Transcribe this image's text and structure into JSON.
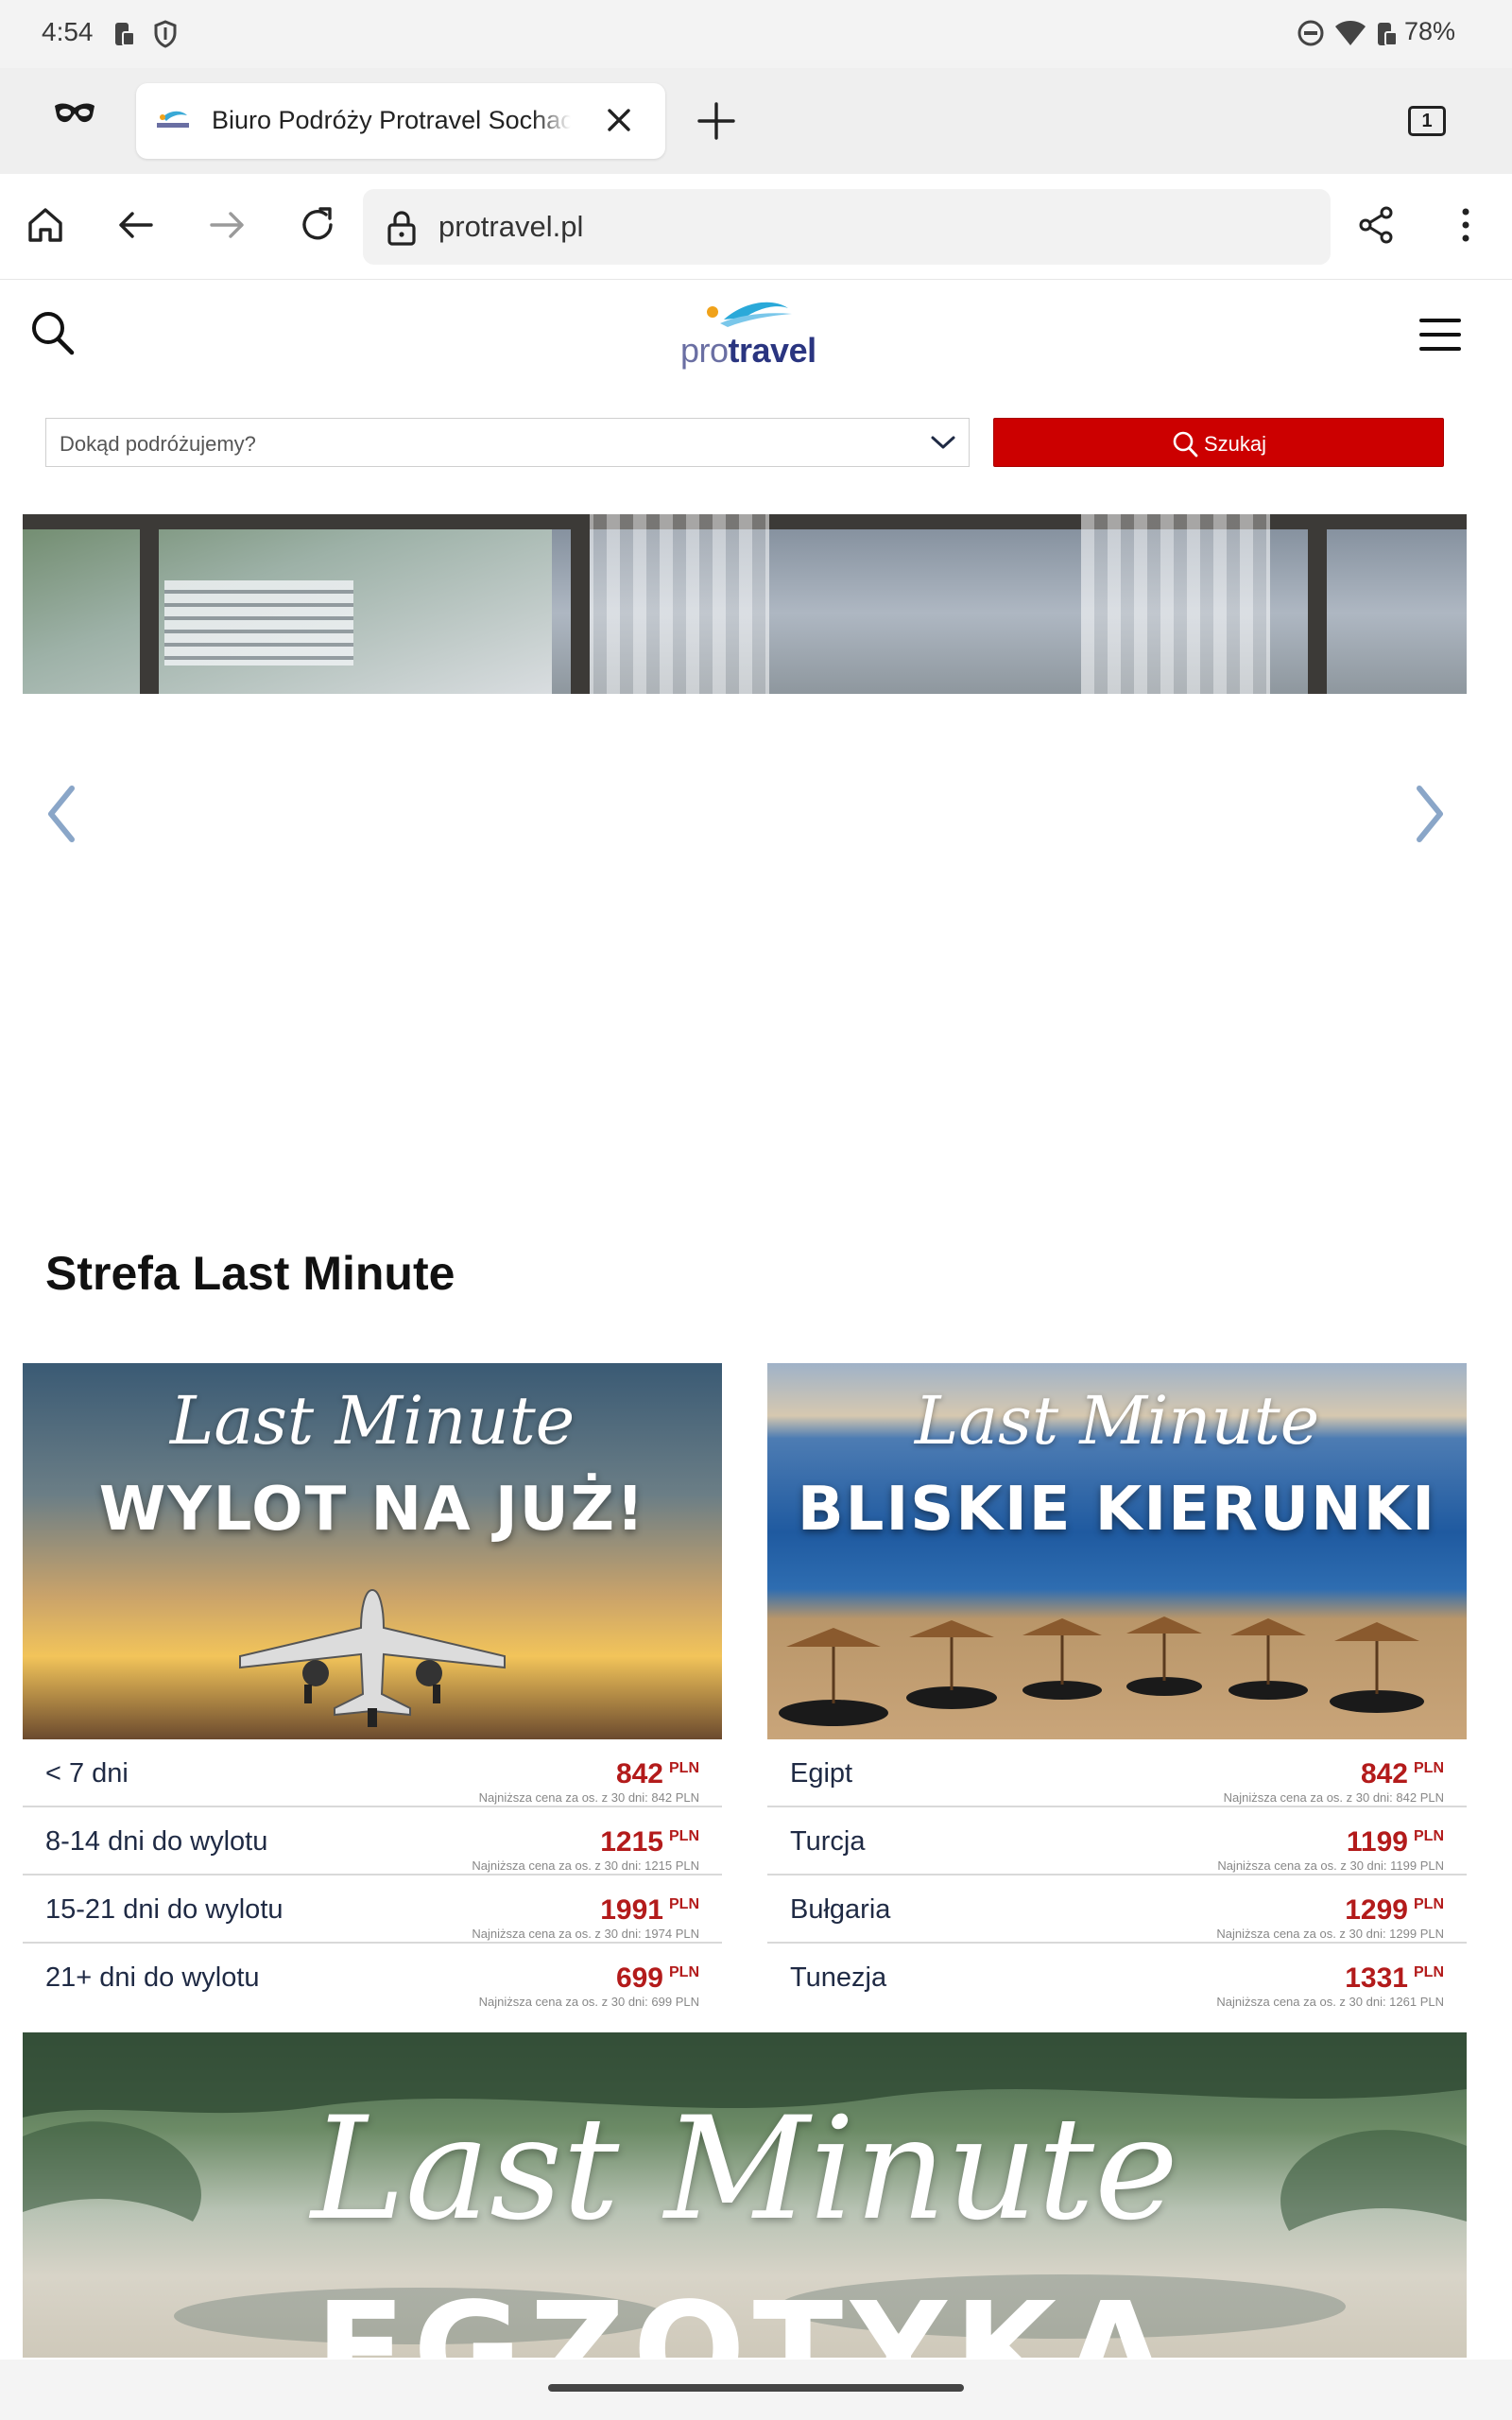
{
  "status_bar": {
    "time": "4:54",
    "battery": "78%"
  },
  "browser": {
    "tab_title": "Biuro Podróży Protravel Sochaczew",
    "tab_count": "1",
    "url": "protravel.pl"
  },
  "site": {
    "logo": {
      "pro": "pro",
      "travel": "travel"
    },
    "search": {
      "destination_placeholder": "Dokąd podróżujemy?",
      "submit_label": "Szukaj"
    },
    "section_title": "Strefa Last Minute",
    "cards": [
      {
        "script": "Last Minute",
        "headline": "WYLOT NA JUŻ!",
        "rows": [
          {
            "label": "< 7 dni",
            "price": "842",
            "currency": "PLN",
            "note": "Najniższa cena za os. z 30 dni: 842 PLN"
          },
          {
            "label": "8-14 dni do wylotu",
            "price": "1215",
            "currency": "PLN",
            "note": "Najniższa cena za os. z 30 dni: 1215 PLN"
          },
          {
            "label": "15-21 dni do wylotu",
            "price": "1991",
            "currency": "PLN",
            "note": "Najniższa cena za os. z 30 dni: 1974 PLN"
          },
          {
            "label": "21+ dni do wylotu",
            "price": "699",
            "currency": "PLN",
            "note": "Najniższa cena za os. z 30 dni: 699 PLN"
          }
        ]
      },
      {
        "script": "Last Minute",
        "headline": "BLISKIE KIERUNKI",
        "rows": [
          {
            "label": "Egipt",
            "price": "842",
            "currency": "PLN",
            "note": "Najniższa cena za os. z 30 dni: 842 PLN"
          },
          {
            "label": "Turcja",
            "price": "1199",
            "currency": "PLN",
            "note": "Najniższa cena za os. z 30 dni: 1199 PLN"
          },
          {
            "label": "Bułgaria",
            "price": "1299",
            "currency": "PLN",
            "note": "Najniższa cena za os. z 30 dni: 1299 PLN"
          },
          {
            "label": "Tunezja",
            "price": "1331",
            "currency": "PLN",
            "note": "Najniższa cena za os. z 30 dni: 1261 PLN"
          }
        ]
      }
    ],
    "banner": {
      "script": "Last Minute",
      "headline": "EGZOTYKA"
    }
  },
  "colors": {
    "accent_red": "#cc0000",
    "price_red": "#b31b1b",
    "brand_navy": "#2a3580"
  },
  "icons": [
    "focus-mode-icon",
    "shield-icon",
    "do-not-disturb-icon",
    "wifi-icon",
    "battery-icon",
    "incognito-icon",
    "close-icon",
    "plus-icon",
    "home-icon",
    "back-arrow-icon",
    "forward-arrow-icon",
    "reload-icon",
    "lock-icon",
    "share-icon",
    "more-vert-icon",
    "search-icon",
    "menu-icon",
    "chevron-down-icon",
    "chevron-left-icon",
    "chevron-right-icon"
  ]
}
